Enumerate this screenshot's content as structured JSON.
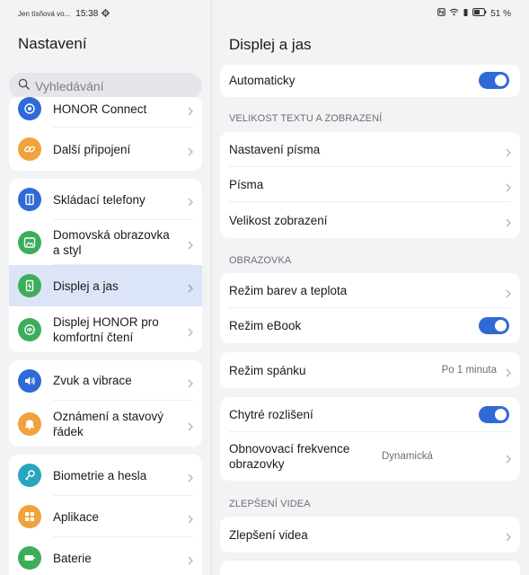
{
  "status_bar": {
    "carrier": "Jen tísňová vo...",
    "time": "15:38",
    "battery": "51 %"
  },
  "left": {
    "title": "Nastavení",
    "search_placeholder": "Vyhledávání",
    "groups": [
      {
        "items": [
          {
            "label": "HONOR Connect",
            "icon": "honor-connect-icon",
            "color": "#2f6ad6"
          },
          {
            "label": "Další připojení",
            "icon": "link-icon",
            "color": "#f0a23b"
          }
        ]
      },
      {
        "items": [
          {
            "label": "Skládací telefony",
            "icon": "foldable-phone-icon",
            "color": "#2f6ad6"
          },
          {
            "label": "Domovská obrazovka a styl",
            "icon": "image-icon",
            "color": "#3cae5a"
          },
          {
            "label": "Displej a jas",
            "icon": "display-brightness-icon",
            "color": "#3cae5a",
            "selected": true
          },
          {
            "label": "Displej HONOR pro komfortní čtení",
            "icon": "eye-comfort-icon",
            "color": "#3cae5a"
          }
        ]
      },
      {
        "items": [
          {
            "label": "Zvuk a vibrace",
            "icon": "speaker-icon",
            "color": "#2f6ad6"
          },
          {
            "label": "Oznámení a stavový řádek",
            "icon": "bell-icon",
            "color": "#f0a23b"
          }
        ]
      },
      {
        "items": [
          {
            "label": "Biometrie a hesla",
            "icon": "key-icon",
            "color": "#27a6bf"
          },
          {
            "label": "Aplikace",
            "icon": "apps-grid-icon",
            "color": "#f0a23b"
          },
          {
            "label": "Baterie",
            "icon": "battery-icon",
            "color": "#3cae5a"
          }
        ]
      }
    ]
  },
  "right": {
    "title": "Displej a jas",
    "auto_label": "Automaticky",
    "auto_on": true,
    "section_text_size": "VELIKOST TEXTU A ZOBRAZENÍ",
    "font_settings": "Nastavení písma",
    "fonts": "Písma",
    "display_size": "Velikost zobrazení",
    "section_screen": "OBRAZOVKA",
    "color_mode": "Režim barev a teplota",
    "ebook_mode": "Režim eBook",
    "ebook_on": true,
    "sleep_mode": "Režim spánku",
    "sleep_value": "Po 1 minuta",
    "smart_resolution": "Chytré rozlišení",
    "smart_resolution_on": true,
    "refresh_rate": "Obnovovací frekvence obrazovky",
    "refresh_value": "Dynamická",
    "section_video": "ZLEPŠENÍ VIDEA",
    "video_enhance": "Zlepšení videa"
  },
  "colors": {
    "accent": "#2f6ad6",
    "selected_bg": "#dbe5f7",
    "page_bg": "#f1f3f5"
  }
}
